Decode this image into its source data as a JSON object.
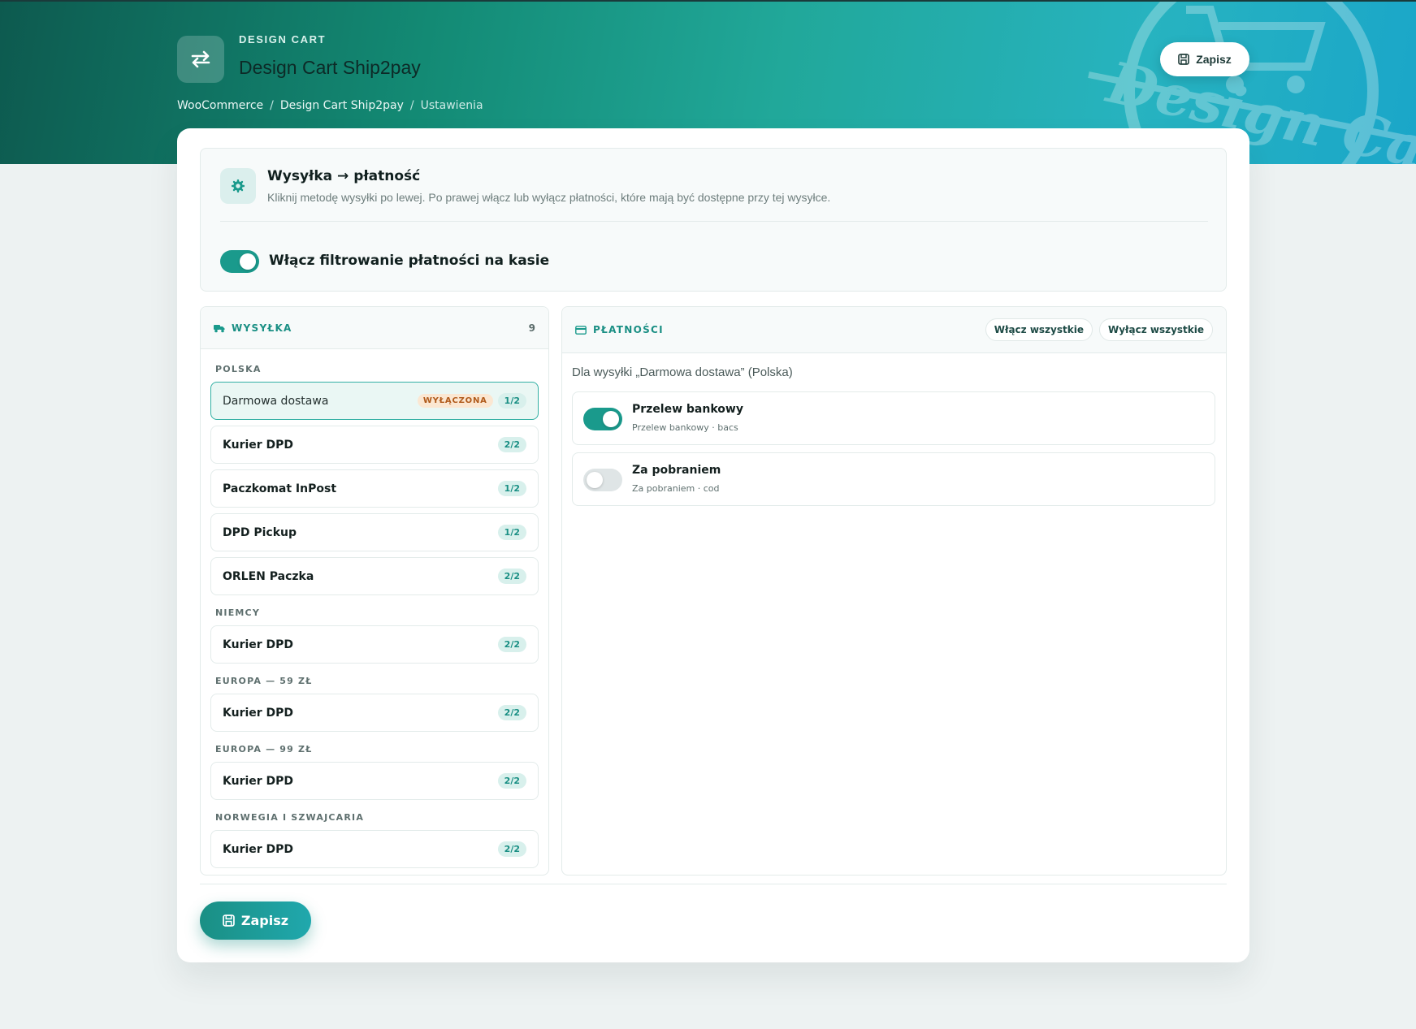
{
  "header": {
    "kicker": "DESIGN CART",
    "title": "Design Cart Ship2pay",
    "save_label": "Zapisz",
    "logo_text": "Design Cart"
  },
  "breadcrumb": {
    "items": [
      "WooCommerce",
      "Design Cart Ship2pay",
      "Ustawienia"
    ],
    "separator": "/"
  },
  "settings": {
    "title": "Wysyłka → płatność",
    "description": "Kliknij metodę wysyłki po lewej. Po prawej włącz lub wyłącz płatności, które mają być dostępne przy tej wysyłce.",
    "toggle_label": "Włącz filtrowanie płatności na kasie",
    "toggle_on": true
  },
  "shipping": {
    "title": "WYSYŁKA",
    "count": "9",
    "groups": [
      {
        "label": "POLSKA",
        "items": [
          {
            "name": "Darmowa dostawa",
            "badge": "WYŁĄCZONA",
            "count": "1/2",
            "active": true
          },
          {
            "name": "Kurier DPD",
            "count": "2/2"
          },
          {
            "name": "Paczkomat InPost",
            "count": "1/2"
          },
          {
            "name": "DPD Pickup",
            "count": "1/2"
          },
          {
            "name": "ORLEN Paczka",
            "count": "2/2"
          }
        ]
      },
      {
        "label": "NIEMCY",
        "items": [
          {
            "name": "Kurier DPD",
            "count": "2/2"
          }
        ]
      },
      {
        "label": "EUROPA — 59 ZŁ",
        "items": [
          {
            "name": "Kurier DPD",
            "count": "2/2"
          }
        ]
      },
      {
        "label": "EUROPA — 99 ZŁ",
        "items": [
          {
            "name": "Kurier DPD",
            "count": "2/2"
          }
        ]
      },
      {
        "label": "NORWEGIA I SZWAJCARIA",
        "items": [
          {
            "name": "Kurier DPD",
            "count": "2/2"
          }
        ]
      }
    ]
  },
  "payments": {
    "title": "PŁATNOŚCI",
    "enable_all": "Włącz wszystkie",
    "disable_all": "Wyłącz wszystkie",
    "context": "Dla wysyłki „Darmowa dostawa” (Polska)",
    "items": [
      {
        "name": "Przelew bankowy",
        "sub": "Przelew bankowy · bacs",
        "enabled": true
      },
      {
        "name": "Za pobraniem",
        "sub": "Za pobraniem · cod",
        "enabled": false
      }
    ]
  },
  "footer": {
    "save_label": "Zapisz"
  },
  "colors": {
    "accent": "#1a9a8c",
    "badge_off": "#b05a1a",
    "page_bg": "#edf2f2"
  }
}
